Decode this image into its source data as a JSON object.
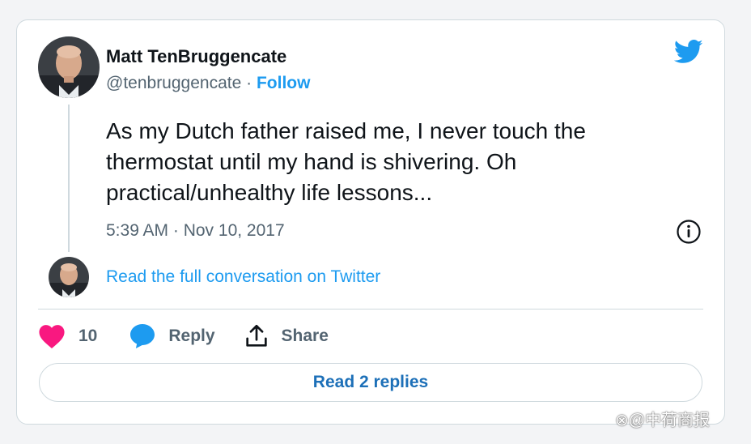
{
  "tweet": {
    "author_name": "Matt TenBruggencate",
    "handle": "@tenbruggencate",
    "separator": " · ",
    "follow_label": "Follow",
    "text": "As my Dutch father raised me, I never touch the thermostat until my hand is shivering. Oh practical/unhealthy life lessons...",
    "timestamp": "5:39 AM · Nov 10, 2017",
    "read_conversation_label": "Read the full conversation on Twitter"
  },
  "actions": {
    "like_count": "10",
    "reply_label": "Reply",
    "share_label": "Share"
  },
  "read_replies_label": "Read 2 replies",
  "watermark": "⊗@中荷商报",
  "icons": {
    "brand": "twitter-bird-icon",
    "info": "info-icon",
    "like": "heart-icon",
    "reply": "speech-bubble-icon",
    "share": "share-icon"
  },
  "colors": {
    "accent": "#1d9bf0",
    "like": "#f91880",
    "text": "#0f1419",
    "muted": "#536471",
    "border": "#cfd9de"
  }
}
